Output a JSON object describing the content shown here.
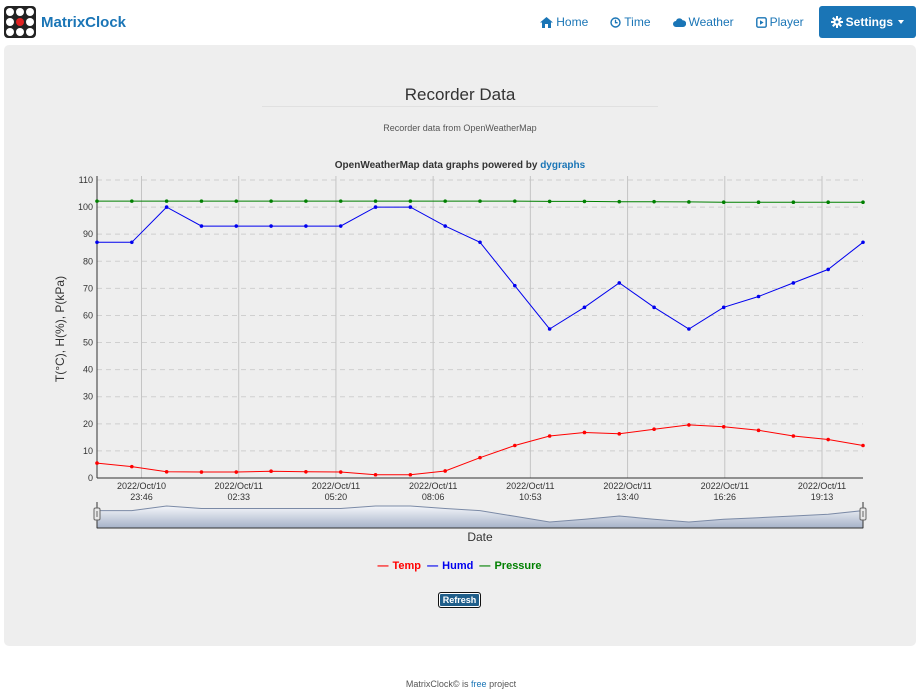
{
  "brand": {
    "name": "MatrixClock"
  },
  "nav": {
    "home": "Home",
    "time": "Time",
    "weather": "Weather",
    "player": "Player",
    "settings": "Settings"
  },
  "page": {
    "title": "Recorder Data",
    "subtitle": "Recorder data from OpenWeatherMap",
    "chart_title_prefix": "OpenWeatherMap data graphs powered by",
    "chart_title_link": "dygraphs",
    "refresh": "Refresh"
  },
  "footer": {
    "prefix": "MatrixClock© is",
    "link": "free",
    "suffix": "project"
  },
  "colors": {
    "temp": "#ff0000",
    "humd": "#0000ee",
    "pressure": "#008000",
    "accent": "#1a75b6"
  },
  "chart_data": {
    "type": "line",
    "ylabel": "T(°C), H(%), P(kPa)",
    "xlabel": "Date",
    "ylim": [
      0,
      110
    ],
    "yticks": [
      0,
      10,
      20,
      30,
      40,
      50,
      60,
      70,
      80,
      90,
      100,
      110
    ],
    "xticks": [
      {
        "date": "2022/Oct/10",
        "time": "23:46"
      },
      {
        "date": "2022/Oct/11",
        "time": "02:33"
      },
      {
        "date": "2022/Oct/11",
        "time": "05:20"
      },
      {
        "date": "2022/Oct/11",
        "time": "08:06"
      },
      {
        "date": "2022/Oct/11",
        "time": "10:53"
      },
      {
        "date": "2022/Oct/11",
        "time": "13:40"
      },
      {
        "date": "2022/Oct/11",
        "time": "16:26"
      },
      {
        "date": "2022/Oct/11",
        "time": "19:13"
      }
    ],
    "legend_position": "bottom",
    "grid": true,
    "series": [
      {
        "name": "Temp",
        "color": "#ff0000",
        "values": [
          5.5,
          4.2,
          2.3,
          2.2,
          2.2,
          2.5,
          2.3,
          2.2,
          1.2,
          1.2,
          2.6,
          7.5,
          12.0,
          15.5,
          16.8,
          16.3,
          18.0,
          19.6,
          18.9,
          17.6,
          15.5,
          14.2,
          12.0
        ]
      },
      {
        "name": "Humd",
        "color": "#0000ee",
        "values": [
          87,
          87,
          100,
          93,
          93,
          93,
          93,
          93,
          100,
          100,
          93,
          87,
          71,
          55,
          63,
          72,
          63,
          55,
          63,
          67,
          72,
          77,
          87
        ]
      },
      {
        "name": "Pressure",
        "color": "#008000",
        "values": [
          102.2,
          102.2,
          102.2,
          102.2,
          102.2,
          102.2,
          102.2,
          102.2,
          102.2,
          102.2,
          102.2,
          102.2,
          102.2,
          102.1,
          102.1,
          102.0,
          102.0,
          101.9,
          101.8,
          101.8,
          101.8,
          101.8,
          101.8
        ]
      }
    ]
  }
}
